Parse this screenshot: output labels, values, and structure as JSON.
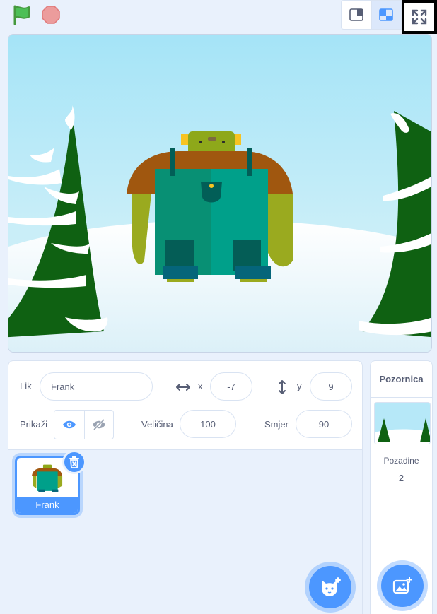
{
  "toolbar": {
    "green_flag_icon": "green-flag-icon",
    "stop_icon": "stop-icon",
    "small_stage_icon": "small-stage-icon",
    "normal_stage_icon": "normal-stage-icon",
    "fullscreen_icon": "fullscreen-icon"
  },
  "sprite_info": {
    "sprite_label": "Lik",
    "sprite_name_value": "Frank",
    "x_label": "x",
    "x_value": "-7",
    "y_label": "y",
    "y_value": "9",
    "show_label": "Prikaži",
    "size_label": "Veličina",
    "size_value": "100",
    "direction_label": "Smjer",
    "direction_value": "90"
  },
  "sprites": [
    {
      "name": "Frank",
      "selected": true
    }
  ],
  "stage_panel": {
    "title": "Pozornica",
    "backdrops_label": "Pozadine",
    "backdrops_count": "2"
  },
  "colors": {
    "accent": "#4c97ff",
    "text": "#575e75",
    "background": "#e9f1fc"
  }
}
